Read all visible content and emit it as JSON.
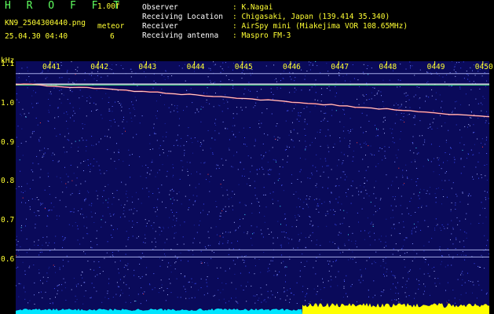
{
  "header": {
    "title": "H R O F F T",
    "version": "1.00f",
    "filename": "KN9_2504300440.png",
    "mode_label": "meteor",
    "mode_value": "6",
    "datetime": "25.04.30 04:40"
  },
  "meta": {
    "observer_label": "Observer",
    "observer_value": ": K.Nagai",
    "location_label": "Receiving Location",
    "location_value": ": Chigasaki, Japan (139.414 35.340)",
    "receiver_label": "Receiver",
    "receiver_value": ": AirSpy mini (Miakejima VOR 108.65MHz)",
    "antenna_label": "Receiving antenna",
    "antenna_value": ": Maspro FM-3"
  },
  "chart_data": {
    "type": "heatmap",
    "y_unit": "kHz",
    "y_ticks": [
      "1.1",
      "1.0",
      "0.9",
      "0.8",
      "0.7",
      "0.6"
    ],
    "x_ticks": [
      "0441",
      "0442",
      "0443",
      "0444",
      "0445",
      "0446",
      "0447",
      "0448",
      "0449",
      "0450"
    ],
    "ylim": [
      0.58,
      1.16
    ],
    "colors": {
      "background": "#0a0a5a",
      "axis_text": "#ffff33",
      "bottom_bar_left": "#00e5ff",
      "bottom_bar_right": "#ffff00"
    },
    "traces": [
      {
        "kind": "flat",
        "freq_start": 1.05,
        "freq_end": 1.05
      },
      {
        "kind": "drifting",
        "freq_start": 1.05,
        "freq_end": 0.965
      }
    ],
    "horizontal_lines_khz": [
      1.077,
      0.625,
      0.607
    ]
  }
}
